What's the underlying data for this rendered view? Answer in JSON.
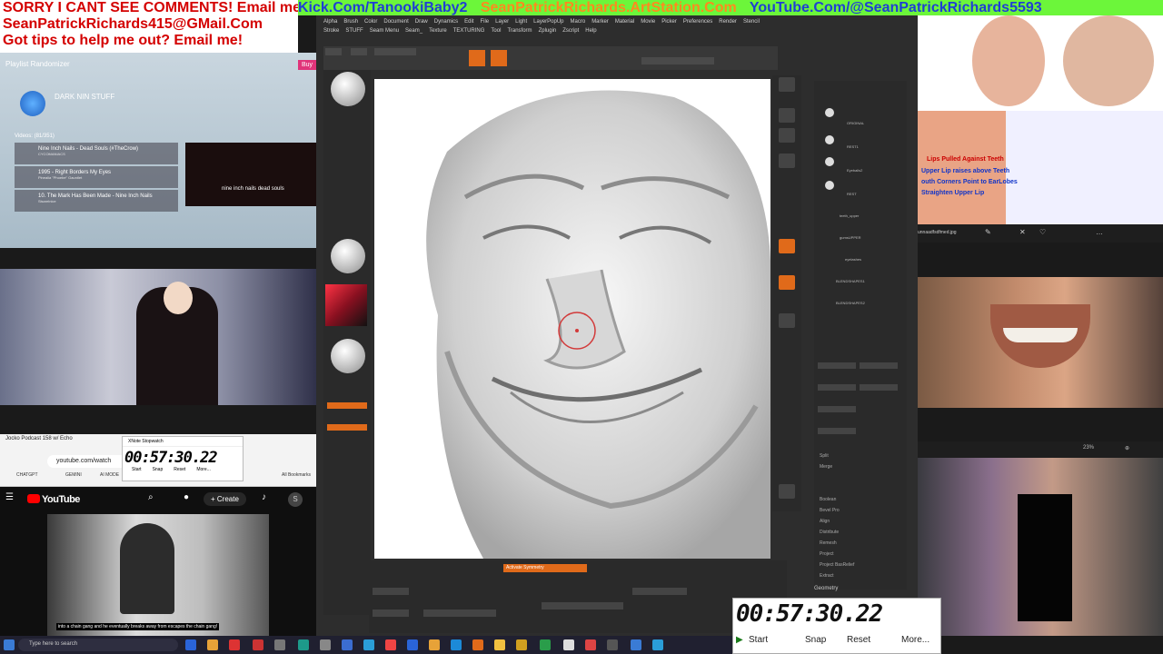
{
  "banners": {
    "left_line1": "SORRY I CANT SEE COMMENTS! Email me:",
    "left_line2": "SeanPatrickRichards415@GMail.Com",
    "left_line3": "Got tips to help me out? Email me!",
    "kick": "Kick.Com/TanookiBaby2",
    "artstation": "SeanPatrickRichards.ArtStation.Com",
    "youtube": "YouTube.Com/@SeanPatrickRichards5593"
  },
  "playlist": {
    "title": "Playlist Randomizer",
    "buy": "Buy",
    "artist": "DARK NIN STUFF",
    "videos_count": "Videos: (81/351)",
    "tracks": [
      {
        "title": "Nine Inch Nails - Dead Souls (#TheCrow)",
        "sub": "CYCOMANIACS"
      },
      {
        "title": "1995 - Right Borders My Eyes",
        "sub": "Pinealia \"Phoebe\" Gauntlet"
      },
      {
        "title": "10. The Mark Has Been Made - Nine Inch Nails",
        "sub": "Sisarelnice"
      }
    ],
    "thumb_caption": "nine inch nails dead souls"
  },
  "browser": {
    "tab": "Jocko Podcast 158 w/ Echo",
    "url": "youtube.com/watch",
    "bookmarks": [
      "CHATGPT",
      "GEMINI",
      "AI MODE",
      "All Bookmarks"
    ]
  },
  "stopwatch_small": {
    "title": "XNote Stopwatch",
    "time": "00:57:30.22",
    "start": "Start",
    "snap": "Snap",
    "reset": "Reset",
    "more": "More..."
  },
  "youtube": {
    "logo": "YouTube",
    "create": "Create",
    "user_initial": "S",
    "caption": "into a chain gang and he eventually breaks away from escapes the chain gang!"
  },
  "zbrush": {
    "menu_row1": [
      "Alpha",
      "Brush",
      "Color",
      "Document",
      "Draw",
      "Dynamics",
      "Edit",
      "File",
      "Layer",
      "Light",
      "LayerPopUp",
      "Macro",
      "Marker",
      "Material",
      "Movie",
      "Picker",
      "Preferences",
      "Render",
      "Stencil"
    ],
    "menu_row2": [
      "Stroke",
      "STUFF",
      "Seam Menu",
      "Seam_",
      "Texture",
      "TEXTURING",
      "Tool",
      "Transform",
      "Zplugin",
      "Zscript",
      "Help"
    ],
    "subtool_names": [
      "ORIGINAL",
      "REST1",
      "Eyeballs2",
      "REST",
      "teeth_upper",
      "gumsUPPER",
      "eyelashes",
      "BLENDSHAPES1",
      "BLENDSHAPES2"
    ],
    "subtool_sections": [
      "Split",
      "Merge",
      "Boolean",
      "Bevel Pro",
      "Align",
      "Distribute",
      "Remesh",
      "Project",
      "Project BasRelief",
      "Extract"
    ],
    "bottom_symmetry": "Activate Symmetry",
    "geometry": "Geometry",
    "top_right_labels": [
      "AlphaBrush",
      "SimpleBrush",
      "ImagePlane_01",
      "ImagePlane_02"
    ]
  },
  "reference": {
    "annotations": [
      "Lips Pulled Against Teeth",
      "Upper Lip raises above Teeth",
      "outh Corners Point to EarLobes",
      "Straighten Upper Lip"
    ],
    "filename": "unnaadfsdfmed.jpg",
    "zoom": "23%"
  },
  "stopwatch_big": {
    "time": "00:57:30.22",
    "start": "Start",
    "snap": "Snap",
    "reset": "Reset",
    "more": "More..."
  },
  "taskbar": {
    "search_placeholder": "Type here to search"
  }
}
